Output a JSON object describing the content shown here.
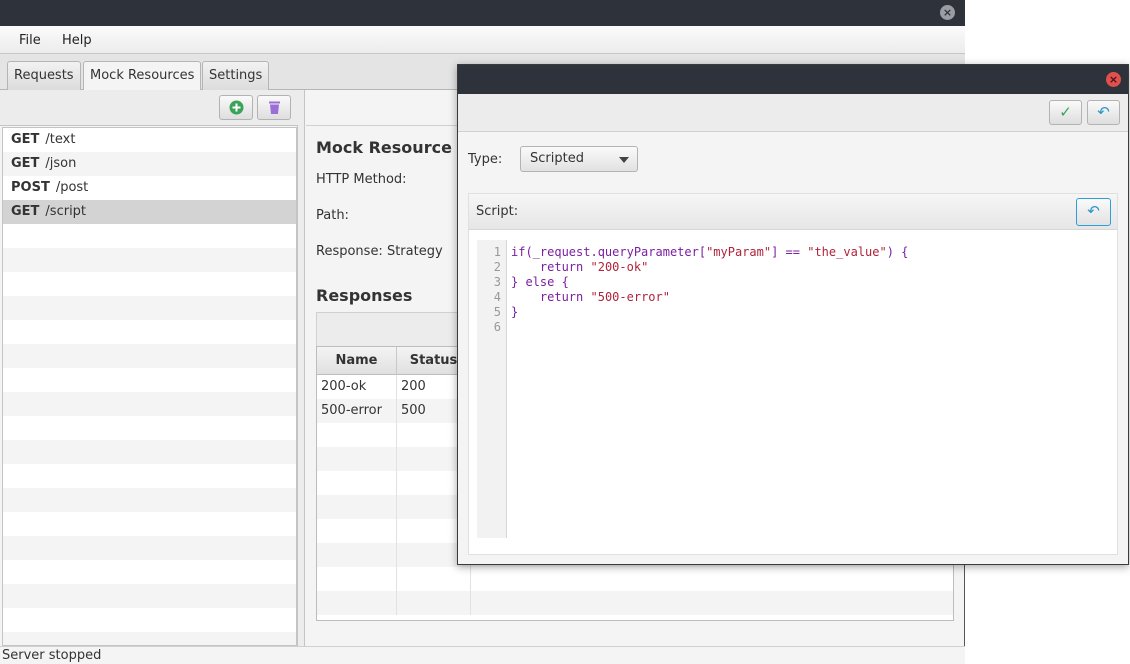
{
  "main": {
    "menu": [
      "File",
      "Help"
    ],
    "tabs": [
      "Requests",
      "Mock Resources",
      "Settings"
    ],
    "active_tab": "Mock Resources",
    "resources": [
      {
        "method": "GET",
        "path": "/text"
      },
      {
        "method": "GET",
        "path": "/json"
      },
      {
        "method": "POST",
        "path": "/post"
      },
      {
        "method": "GET",
        "path": "/script"
      }
    ],
    "selected_resource": "GET /script",
    "detail": {
      "title": "Mock Resource",
      "http_method_label": "HTTP Method:",
      "path_label": "Path:",
      "strategy_label": "Response: Strategy"
    },
    "responses": {
      "title": "Responses",
      "columns": [
        "Name",
        "Status"
      ],
      "rows": [
        {
          "name": "200-ok",
          "status": "200"
        },
        {
          "name": "500-error",
          "status": "500"
        }
      ]
    },
    "status": "Server stopped"
  },
  "dialog": {
    "type_label": "Type:",
    "type_value": "Scripted",
    "script_label": "Script:",
    "line_numbers": [
      "1",
      "2",
      "3",
      "4",
      "5",
      "6"
    ],
    "script_lines": [
      "if(_request.queryParameter[\"myParam\"] == \"the_value\") {",
      "    return \"200-ok\"",
      "} else {",
      "    return \"500-error\"",
      "}",
      ""
    ],
    "script_tokens": {
      "l1_a": "if(_request.queryParameter[",
      "l1_b": "\"myParam\"",
      "l1_c": "] == ",
      "l1_d": "\"the_value\"",
      "l1_e": ") {",
      "l2_kw": "return",
      "l2_str": "\"200-ok\"",
      "l3_a": "} ",
      "l3_kw": "else",
      "l3_b": " {",
      "l4_kw": "return",
      "l4_str": "\"500-error\"",
      "l5": "}"
    }
  },
  "icons": {
    "close": "close-icon",
    "add": "add-icon",
    "delete": "trash-icon",
    "confirm": "check-icon",
    "undo": "undo-icon"
  },
  "colors": {
    "titlebar": "#2e323a",
    "accent_green": "#3aa35a",
    "accent_blue": "#2a95c8",
    "close_red": "#e0504f",
    "trash_purple": "#9b6fd6"
  }
}
